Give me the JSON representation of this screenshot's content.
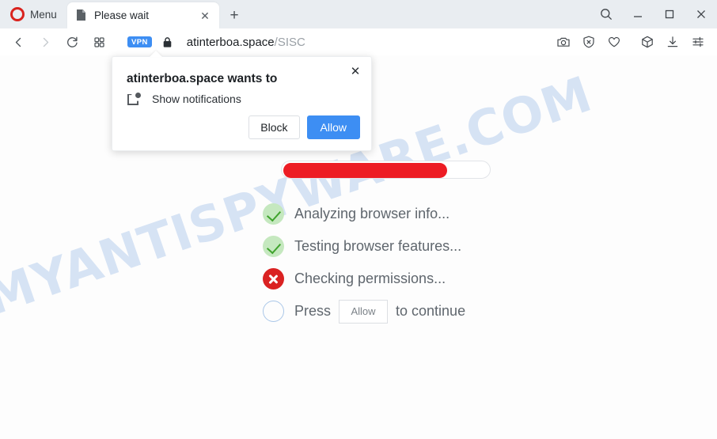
{
  "browser": {
    "menu_label": "Menu",
    "logo_name": "opera-logo",
    "tab": {
      "title": "Please wait",
      "favicon_name": "page-favicon",
      "close_label": "✕"
    },
    "new_tab_label": "+",
    "window_controls": {
      "search": "search-icon",
      "minimize": "minimize-icon",
      "maximize": "maximize-icon",
      "close": "close-icon"
    },
    "nav": {
      "back": "back-arrow-icon",
      "forward": "forward-arrow-icon",
      "reload": "reload-icon",
      "speed_dial": "speed-dial-icon"
    },
    "address": {
      "vpn_badge": "VPN",
      "lock": "lock-icon",
      "domain": "atinterboa.space",
      "path": "/SISC"
    },
    "toolbar_icons": [
      "snapshot-camera-icon",
      "ad-blocker-shield-icon",
      "heart-icon",
      "cube-icon",
      "download-icon",
      "easy-setup-sliders-icon"
    ]
  },
  "permission_dialog": {
    "title": "atinterboa.space wants to",
    "request_icon": "notification-icon",
    "request_text": "Show notifications",
    "block_label": "Block",
    "allow_label": "Allow",
    "close_label": "✕"
  },
  "page": {
    "watermark": "MYANTISPYWARE.COM",
    "progress": {
      "percent": 80,
      "fill_color": "#ed1c24"
    },
    "checklist": [
      {
        "status": "ok",
        "text": "Analyzing browser info..."
      },
      {
        "status": "ok",
        "text": "Testing browser features..."
      },
      {
        "status": "error",
        "text": "Checking permissions..."
      }
    ],
    "press_row": {
      "status": "pending",
      "prefix": "Press",
      "button_label": "Allow",
      "suffix": "to continue"
    }
  },
  "colors": {
    "accent_blue": "#3d8ef3",
    "danger_red": "#ed1c24",
    "success_green": "#3fa32c",
    "error_circle": "#da2222",
    "watermark": "#ccdcf2",
    "tabbar_bg": "#e9edf1"
  }
}
